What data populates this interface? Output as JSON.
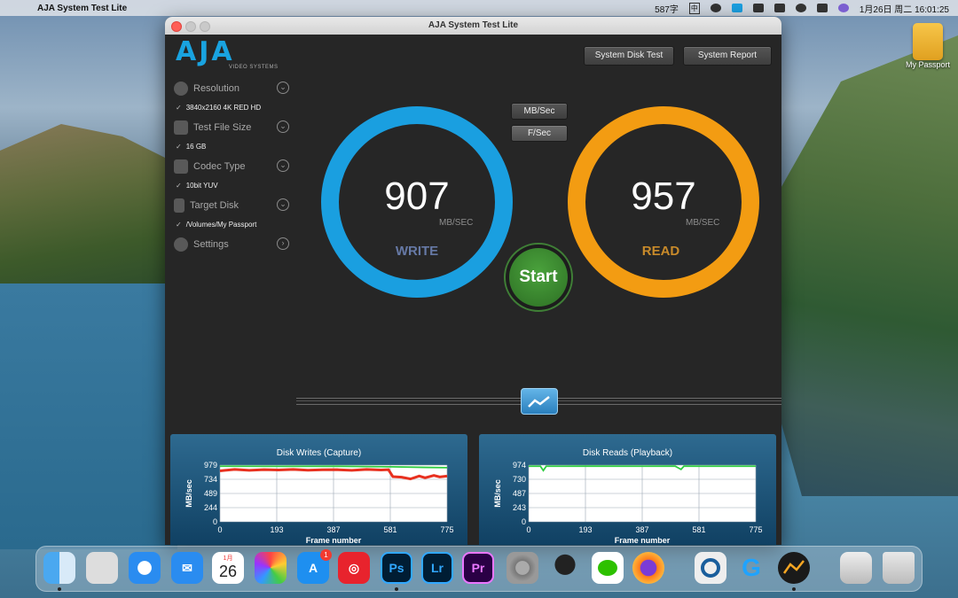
{
  "menubar": {
    "app_name": "AJA System Test Lite",
    "char_count": "587字",
    "ime": "中",
    "datetime": "1月26日 周二  16:01:25"
  },
  "desktop": {
    "drive_label": "My Passport"
  },
  "window": {
    "title": "AJA System Test Lite",
    "logo_text": "AJA",
    "logo_subtitle": "VIDEO SYSTEMS",
    "buttons": {
      "system_disk_test": "System Disk Test",
      "system_report": "System Report",
      "mb_sec": "MB/Sec",
      "f_sec": "F/Sec",
      "start": "Start"
    },
    "sidebar": {
      "resolution_label": "Resolution",
      "resolution_value": "3840x2160 4K RED HD",
      "test_file_size_label": "Test File Size",
      "test_file_size_value": "16 GB",
      "codec_type_label": "Codec Type",
      "codec_type_value": "10bit YUV",
      "target_disk_label": "Target Disk",
      "target_disk_value": "/Volumes/My Passport",
      "settings_label": "Settings",
      "checkmark": "✓",
      "chevron": "⌄",
      "chevron_right": "›"
    },
    "write_gauge": {
      "value": "907",
      "unit": "MB/SEC",
      "label": "WRITE",
      "color": "#1a9fe0"
    },
    "read_gauge": {
      "value": "957",
      "unit": "MB/SEC",
      "label": "READ",
      "color": "#f39c12"
    }
  },
  "chart_data": [
    {
      "type": "line",
      "title": "Disk Writes (Capture)",
      "xlabel": "Frame number",
      "ylabel": "MB/sec",
      "x_ticks": [
        "0",
        "193",
        "387",
        "581",
        "775"
      ],
      "y_ticks": [
        "979",
        "734",
        "489",
        "244",
        "0"
      ],
      "xlim": [
        0,
        775
      ],
      "ylim": [
        0,
        979
      ],
      "grid": true,
      "series": [
        {
          "color": "#e8301e",
          "x": [
            0,
            50,
            100,
            150,
            200,
            250,
            300,
            350,
            400,
            450,
            500,
            550,
            575,
            590,
            620,
            650,
            680,
            700,
            730,
            750,
            775
          ],
          "y": [
            880,
            905,
            890,
            900,
            895,
            905,
            892,
            898,
            900,
            890,
            905,
            895,
            900,
            780,
            770,
            740,
            790,
            760,
            800,
            775,
            790
          ]
        },
        {
          "color": "#2ecc40",
          "x": [
            0,
            200,
            400,
            581,
            700,
            775
          ],
          "y": [
            960,
            958,
            959,
            950,
            940,
            935
          ]
        }
      ]
    },
    {
      "type": "line",
      "title": "Disk Reads (Playback)",
      "xlabel": "Frame number",
      "ylabel": "MB/sec",
      "x_ticks": [
        "0",
        "193",
        "387",
        "581",
        "775"
      ],
      "y_ticks": [
        "974",
        "730",
        "487",
        "243",
        "0"
      ],
      "xlim": [
        0,
        775
      ],
      "ylim": [
        0,
        974
      ],
      "grid": true,
      "series": [
        {
          "color": "#2ecc40",
          "x": [
            0,
            40,
            50,
            60,
            193,
            387,
            500,
            520,
            530,
            581,
            775
          ],
          "y": [
            955,
            955,
            880,
            955,
            956,
            955,
            956,
            900,
            956,
            955,
            955
          ]
        }
      ]
    }
  ],
  "dock": {
    "calendar_month": "1月",
    "calendar_day": "26",
    "appstore_badge": "1",
    "ps": "Ps",
    "lr": "Lr",
    "pr": "Pr"
  }
}
